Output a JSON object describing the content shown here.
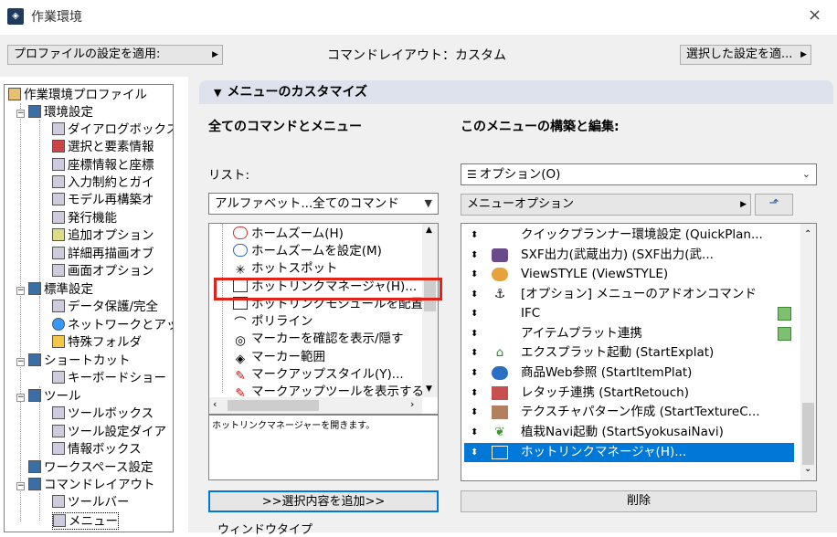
{
  "window": {
    "title": "作業環境",
    "close_icon": "×"
  },
  "topbar": {
    "profile_button": "プロファイルの設定を適用:",
    "layout_label": "コマンドレイアウト：カスタム",
    "apply_button": "選択した設定を適..."
  },
  "tree": {
    "items": [
      {
        "label": "作業環境プロファイル",
        "icon": "profile-icon"
      },
      {
        "label": "環境設定",
        "icon": "settings-icon"
      },
      {
        "label": "ダイアログボックス",
        "icon": "dialog-icon"
      },
      {
        "label": "選択と要素情報",
        "icon": "select-icon"
      },
      {
        "label": "座標情報と座標",
        "icon": "coord-icon"
      },
      {
        "label": "入力制約とガイ",
        "icon": "input-icon"
      },
      {
        "label": "モデル再構築オ",
        "icon": "model-icon"
      },
      {
        "label": "発行機能",
        "icon": "publish-icon"
      },
      {
        "label": "追加オプション",
        "icon": "addon-icon"
      },
      {
        "label": "詳細再描画オブ",
        "icon": "redraw-icon"
      },
      {
        "label": "画面オプション",
        "icon": "screen-icon"
      },
      {
        "label": "標準設定",
        "icon": "standard-icon"
      },
      {
        "label": "データ保護/完全",
        "icon": "data-icon"
      },
      {
        "label": "ネットワークとアッ",
        "icon": "network-icon"
      },
      {
        "label": "特殊フォルダ",
        "icon": "folder-icon"
      },
      {
        "label": "ショートカット",
        "icon": "shortcut-icon"
      },
      {
        "label": "キーボードショー",
        "icon": "keyboard-icon"
      },
      {
        "label": "ツール",
        "icon": "tool-icon"
      },
      {
        "label": "ツールボックス",
        "icon": "toolbox-icon"
      },
      {
        "label": "ツール設定ダイア",
        "icon": "toolsettings-icon"
      },
      {
        "label": "情報ボックス",
        "icon": "infobox-icon"
      },
      {
        "label": "ワークスペース設定",
        "icon": "workspace-icon"
      },
      {
        "label": "コマンドレイアウト",
        "icon": "layout-icon"
      },
      {
        "label": "ツールバー",
        "icon": "toolbar-icon"
      },
      {
        "label": "メニュー",
        "icon": "menu-icon"
      }
    ]
  },
  "section": {
    "title": "メニューのカスタマイズ"
  },
  "left": {
    "heading": "全てのコマンドとメニュー",
    "list_label": "リスト:",
    "list_value": "アルファベット...全てのコマンド",
    "commands": [
      "ホームズーム(H)",
      "ホームズームを設定(M)",
      "ホットスポット",
      "ホットリンクマネージャ(H)...",
      "ホットリンクモジュールを配置",
      "ポリライン",
      "マーカーを確認を表示/隠す",
      "マーカー範囲",
      "マークアップスタイル(Y)...",
      "マークアップツールを表示する"
    ],
    "description": "ホットリンクマネージャーを開きます。",
    "add_button": ">>選択内容を追加>>",
    "window_type_label": "ウィンドウタイプ"
  },
  "right": {
    "heading": "このメニューの構築と編集:",
    "menu_value": "オプション(O)",
    "submenu_value": "メニューオプション",
    "items": [
      "クイックプランナー環境設定 (QuickPlan...",
      "SXF出力(武蔵出力) (SXF出力(武...",
      "ViewSTYLE (ViewSTYLE)",
      "[オプション] メニューのアドオンコマンド",
      "IFC",
      "アイテムプラット連携",
      "エクスプラット起動 (StartExplat)",
      "商品Web参照 (StartItemPlat)",
      "レタッチ連携 (StartRetouch)",
      "テクスチャパターン作成 (StartTextureC...",
      "植栽Navi起動 (StartSyokusaiNavi)",
      "ホットリンクマネージャ(H)..."
    ],
    "delete_button": "削除"
  }
}
